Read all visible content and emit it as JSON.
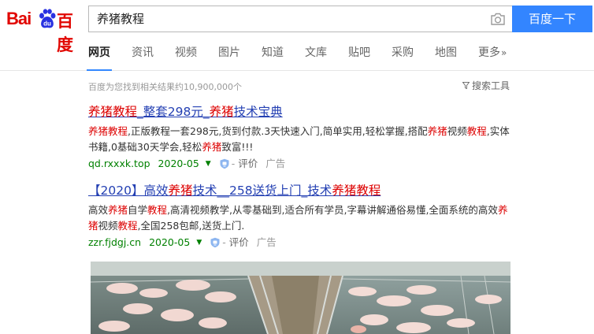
{
  "logo": {
    "part1": "Bai",
    "part2": "百度"
  },
  "search": {
    "query": "养猪教程",
    "button_label": "百度一下"
  },
  "tabs": [
    {
      "label": "网页",
      "active": true
    },
    {
      "label": "资讯"
    },
    {
      "label": "视频"
    },
    {
      "label": "图片"
    },
    {
      "label": "知道"
    },
    {
      "label": "文库"
    },
    {
      "label": "贴吧"
    },
    {
      "label": "采购"
    },
    {
      "label": "地图"
    },
    {
      "label": "更多",
      "suffix": "»"
    }
  ],
  "stats": "百度为您找到相关结果约10,900,000个",
  "search_tools": "搜索工具",
  "results": [
    {
      "title_parts": [
        {
          "text": "养猪教程",
          "hl": true
        },
        {
          "text": "_整套298元_"
        },
        {
          "text": "养猪",
          "hl": true
        },
        {
          "text": "技术宝典"
        }
      ],
      "abstract_parts": [
        {
          "text": "养猪教程",
          "hl": true
        },
        {
          "text": ",正版教程一套298元,货到付款.3天快速入门,简单实用,轻松掌握,搭配"
        },
        {
          "text": "养猪",
          "hl": true
        },
        {
          "text": "视频"
        },
        {
          "text": "教程",
          "hl": true
        },
        {
          "text": ",实体书籍,0基础30天学会,轻松"
        },
        {
          "text": "养猪",
          "hl": true
        },
        {
          "text": "致富!!!"
        }
      ],
      "url": "qd.rxxxk.top",
      "date": "2020-05",
      "eval": "评价",
      "ad": "广告"
    },
    {
      "title_parts": [
        {
          "text": "【2020】高效"
        },
        {
          "text": "养猪",
          "hl": true
        },
        {
          "text": "技术__258送货上门_技术"
        },
        {
          "text": "养猪教程",
          "hl": true
        }
      ],
      "abstract_parts": [
        {
          "text": "高效"
        },
        {
          "text": "养猪",
          "hl": true
        },
        {
          "text": "自学"
        },
        {
          "text": "教程",
          "hl": true
        },
        {
          "text": ",高清视频教学,从零基础到,适合所有学员,字幕讲解通俗易懂,全面系统的高效"
        },
        {
          "text": "养猪",
          "hl": true
        },
        {
          "text": "视频"
        },
        {
          "text": "教程",
          "hl": true
        },
        {
          "text": ",全国258包邮,送货上门."
        }
      ],
      "url": "zzr.fjdgj.cn",
      "date": "2020-05",
      "eval": "评价",
      "ad": "广告"
    }
  ],
  "colors": {
    "brand_red": "#e10601",
    "brand_blue": "#2932e1",
    "button_blue": "#3385ff",
    "link_blue": "#2440b3",
    "highlight_red": "#dd0000",
    "url_green": "#008000"
  },
  "icons": [
    "baidu-paw-icon",
    "camera-icon",
    "funnel-icon",
    "shield-icon"
  ]
}
